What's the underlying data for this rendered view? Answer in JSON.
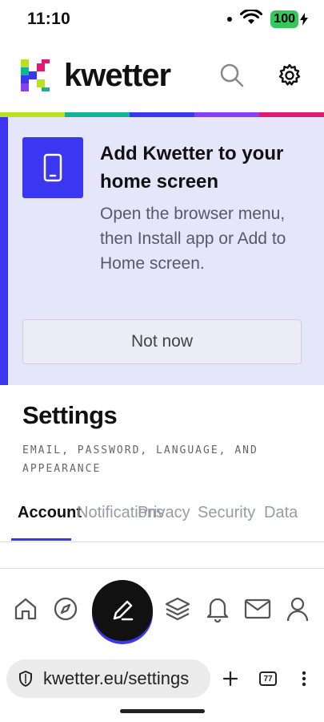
{
  "status": {
    "time": "11:10",
    "battery": "100"
  },
  "header": {
    "brand": "kwetter"
  },
  "install_banner": {
    "title": "Add Kwetter to your home screen",
    "text": "Open the browser menu, then Install app or Add to Home screen.",
    "dismiss_label": "Not now"
  },
  "settings": {
    "title": "Settings",
    "subtitle": "Email, password, language, and appearance",
    "tabs": [
      {
        "label": "Account",
        "active": true
      },
      {
        "label": "Notifications",
        "active": false
      },
      {
        "label": "Privacy",
        "active": false
      },
      {
        "label": "Security",
        "active": false
      },
      {
        "label": "Data",
        "active": false
      }
    ]
  },
  "bottom_nav": {
    "items": [
      "home-icon",
      "explore-icon",
      "compose-icon",
      "layers-icon",
      "bell-icon",
      "mail-icon",
      "profile-icon"
    ]
  },
  "browser": {
    "url": "kwetter.eu/settings",
    "tab_count": "77"
  },
  "colors": {
    "accent": "#3b37f0",
    "banner_bg": "#e6e6fa",
    "rainbow": [
      "#b8e21f",
      "#12b39a",
      "#3b37f0",
      "#8c3ff0",
      "#e01a70"
    ]
  }
}
